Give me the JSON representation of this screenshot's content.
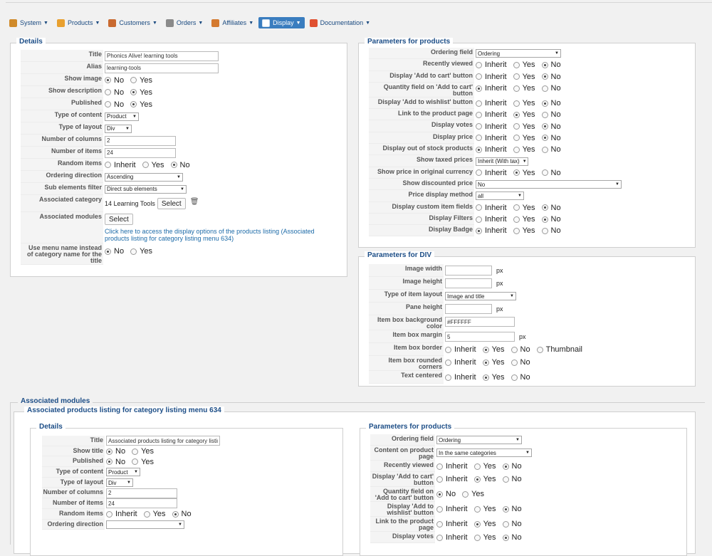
{
  "menu": [
    {
      "label": "System",
      "icon": "wrench-icon",
      "color": "#d08a2a",
      "active": false
    },
    {
      "label": "Products",
      "icon": "products-icon",
      "color": "#e8a030",
      "active": false
    },
    {
      "label": "Customers",
      "icon": "customers-icon",
      "color": "#c96a30",
      "active": false
    },
    {
      "label": "Orders",
      "icon": "orders-icon",
      "color": "#8a8a8a",
      "active": false
    },
    {
      "label": "Affiliates",
      "icon": "affiliates-icon",
      "color": "#d47a30",
      "active": false
    },
    {
      "label": "Display",
      "icon": "display-icon",
      "color": "#ffffff",
      "active": true
    },
    {
      "label": "Documentation",
      "icon": "lifebuoy-icon",
      "color": "#e05030",
      "active": false
    }
  ],
  "details": {
    "legend": "Details",
    "rows": [
      {
        "label": "Title",
        "type": "text",
        "value": "Phonics Alive! learning tools",
        "w": 160
      },
      {
        "label": "Alias",
        "type": "text",
        "value": "learning-tools",
        "w": 160
      },
      {
        "label": "Show image",
        "type": "radio",
        "options": [
          "No",
          "Yes"
        ],
        "selected": 0
      },
      {
        "label": "Show description",
        "type": "radio",
        "options": [
          "No",
          "Yes"
        ],
        "selected": 1
      },
      {
        "label": "Published",
        "type": "radio",
        "options": [
          "No",
          "Yes"
        ],
        "selected": 1
      },
      {
        "label": "Type of content",
        "type": "select",
        "value": "Product",
        "w": 48
      },
      {
        "label": "Type of layout",
        "type": "select",
        "value": "Div",
        "w": 38
      },
      {
        "label": "Number of columns",
        "type": "text",
        "value": "2",
        "w": 100
      },
      {
        "label": "Number of items",
        "type": "text",
        "value": "24",
        "w": 100
      },
      {
        "label": "Random items",
        "type": "radio",
        "options": [
          "Inherit",
          "Yes",
          "No"
        ],
        "selected": 2
      },
      {
        "label": "Ordering direction",
        "type": "select",
        "value": "Ascending",
        "w": 110
      },
      {
        "label": "Sub elements filter",
        "type": "select",
        "value": "Direct sub elements",
        "w": 115
      },
      {
        "label": "Associated category",
        "type": "category",
        "value": "14 Learning Tools",
        "button": "Select"
      },
      {
        "label": "Associated modules",
        "type": "modules",
        "button": "Select",
        "link": "Click here to access the display options of the products listing (Associated products listing for category listing menu 634)"
      },
      {
        "label": "Use menu name instead of category name for the title",
        "type": "radio",
        "options": [
          "No",
          "Yes"
        ],
        "selected": 0
      }
    ]
  },
  "params": {
    "legend": "Parameters for products",
    "rows": [
      {
        "label": "Ordering field",
        "type": "select",
        "value": "Ordering",
        "w": 120
      },
      {
        "label": "Recently viewed",
        "type": "radio",
        "options": [
          "Inherit",
          "Yes",
          "No"
        ],
        "selected": 2
      },
      {
        "label": "Display 'Add to cart' button",
        "type": "radio",
        "options": [
          "Inherit",
          "Yes",
          "No"
        ],
        "selected": 2
      },
      {
        "label": "Quantity field on 'Add to cart' button",
        "type": "radio",
        "options": [
          "Inherit",
          "Yes",
          "No"
        ],
        "selected": 0
      },
      {
        "label": "Display 'Add to wishlist' button",
        "type": "radio",
        "options": [
          "Inherit",
          "Yes",
          "No"
        ],
        "selected": 2
      },
      {
        "label": "Link to the product page",
        "type": "radio",
        "options": [
          "Inherit",
          "Yes",
          "No"
        ],
        "selected": 1
      },
      {
        "label": "Display votes",
        "type": "radio",
        "options": [
          "Inherit",
          "Yes",
          "No"
        ],
        "selected": 2
      },
      {
        "label": "Display price",
        "type": "radio",
        "options": [
          "Inherit",
          "Yes",
          "No"
        ],
        "selected": 2
      },
      {
        "label": "Display out of stock products",
        "type": "radio",
        "options": [
          "Inherit",
          "Yes",
          "No"
        ],
        "selected": 0
      },
      {
        "label": "Show taxed prices",
        "type": "select",
        "value": "Inherit (With tax)",
        "w": 74
      },
      {
        "label": "Show price in original currency",
        "type": "radio",
        "options": [
          "Inherit",
          "Yes",
          "No"
        ],
        "selected": 1
      },
      {
        "label": "Show discounted price",
        "type": "select",
        "value": "No",
        "w": 205
      },
      {
        "label": "Price display method",
        "type": "select",
        "value": "all",
        "w": 68
      },
      {
        "label": "Display custom item fields",
        "type": "radio",
        "options": [
          "Inherit",
          "Yes",
          "No"
        ],
        "selected": 2
      },
      {
        "label": "Display Filters",
        "type": "radio",
        "options": [
          "Inherit",
          "Yes",
          "No"
        ],
        "selected": 2
      },
      {
        "label": "Display Badge",
        "type": "radio",
        "options": [
          "Inherit",
          "Yes",
          "No"
        ],
        "selected": 0
      }
    ]
  },
  "div": {
    "legend": "Parameters for DIV",
    "rows": [
      {
        "label": "Image width",
        "type": "px",
        "value": "",
        "w": 66,
        "unit": "px"
      },
      {
        "label": "Image height",
        "type": "px",
        "value": "",
        "w": 66,
        "unit": "px"
      },
      {
        "label": "Type of item layout",
        "type": "select",
        "value": "Image and title",
        "w": 100
      },
      {
        "label": "Pane height",
        "type": "px",
        "value": "",
        "w": 66,
        "unit": "px"
      },
      {
        "label": "Item box background color",
        "type": "text",
        "value": "#FFFFFF",
        "w": 98
      },
      {
        "label": "Item box margin",
        "type": "px",
        "value": "5",
        "w": 98,
        "unit": "px"
      },
      {
        "label": "Item box border",
        "type": "radio",
        "options": [
          "Inherit",
          "Yes",
          "No",
          "Thumbnail"
        ],
        "selected": 1
      },
      {
        "label": "Item box rounded corners",
        "type": "radio",
        "options": [
          "Inherit",
          "Yes",
          "No"
        ],
        "selected": 1
      },
      {
        "label": "Text centered",
        "type": "radio",
        "options": [
          "Inherit",
          "Yes",
          "No"
        ],
        "selected": 1
      }
    ]
  },
  "assoc": {
    "legend": "Associated modules",
    "sublegend": "Associated products listing for category listing menu 634",
    "details": {
      "legend": "Details",
      "rows": [
        {
          "label": "Title",
          "type": "text",
          "value": "Associated products listing for category listing",
          "w": 160
        },
        {
          "label": "Show title",
          "type": "radio",
          "options": [
            "No",
            "Yes"
          ],
          "selected": 0
        },
        {
          "label": "Published",
          "type": "radio",
          "options": [
            "No",
            "Yes"
          ],
          "selected": 0
        },
        {
          "label": "Type of content",
          "type": "select",
          "value": "Product",
          "w": 48
        },
        {
          "label": "Type of layout",
          "type": "select",
          "value": "Div",
          "w": 38
        },
        {
          "label": "Number of columns",
          "type": "text",
          "value": "2",
          "w": 100
        },
        {
          "label": "Number of items",
          "type": "text",
          "value": "24",
          "w": 100
        },
        {
          "label": "Random items",
          "type": "radio",
          "options": [
            "Inherit",
            "Yes",
            "No"
          ],
          "selected": 2
        },
        {
          "label": "Ordering direction",
          "type": "select",
          "value": "",
          "w": 110
        }
      ]
    },
    "params": {
      "legend": "Parameters for products",
      "rows": [
        {
          "label": "Ordering field",
          "type": "select",
          "value": "Ordering",
          "w": 120
        },
        {
          "label": "Content on product page",
          "type": "select",
          "value": "In the same categories",
          "w": 134
        },
        {
          "label": "Recently viewed",
          "type": "radio",
          "options": [
            "Inherit",
            "Yes",
            "No"
          ],
          "selected": 2
        },
        {
          "label": "Display 'Add to cart' button",
          "type": "radio",
          "options": [
            "Inherit",
            "Yes",
            "No"
          ],
          "selected": 1
        },
        {
          "label": "Quantity field on 'Add to cart' button",
          "type": "radio",
          "options": [
            "No",
            "Yes"
          ],
          "selected": 0
        },
        {
          "label": "Display 'Add to wishlist' button",
          "type": "radio",
          "options": [
            "Inherit",
            "Yes",
            "No"
          ],
          "selected": 2
        },
        {
          "label": "Link to the product page",
          "type": "radio",
          "options": [
            "Inherit",
            "Yes",
            "No"
          ],
          "selected": 1
        },
        {
          "label": "Display votes",
          "type": "radio",
          "options": [
            "Inherit",
            "Yes",
            "No"
          ],
          "selected": 2
        }
      ]
    }
  }
}
